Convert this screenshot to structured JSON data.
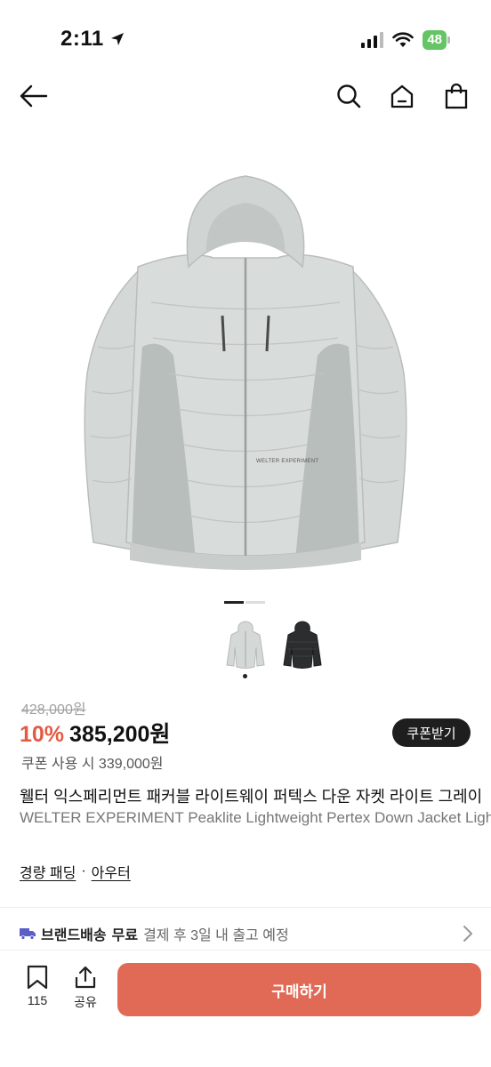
{
  "status": {
    "time": "2:11",
    "battery": "48"
  },
  "product": {
    "original_price": "428,000원",
    "discount": "10%",
    "sale_price": "385,200원",
    "coupon_button": "쿠폰받기",
    "coupon_price": "쿠폰 사용 시 339,000원",
    "title_ko": "웰터 익스페리먼트 패커블 라이트웨이 퍼텍스 다운 자켓 라이트 그레이",
    "title_en": "WELTER EXPERIMENT Peaklite Lightweight Pertex Down Jacket Light Grey",
    "jacket_print": "WELTER EXPERIMENT"
  },
  "category": {
    "first": "경량 패딩",
    "sep": "·",
    "second": "아우터"
  },
  "shipping": {
    "brand": "브랜드배송",
    "free": "무료",
    "eta": "결제 후 3일 내 출고 예정"
  },
  "bottom": {
    "likes": "115",
    "share": "공유",
    "buy": "구매하기"
  },
  "colors": {
    "accent": "#e16a56",
    "discount": "#e25b44",
    "jacket": "#d4d8d6",
    "jacket_panel": "#b8bebc"
  },
  "icons": [
    "back-arrow-icon",
    "search-icon",
    "home-icon",
    "shopping-bag-icon",
    "truck-icon",
    "chevron-right-icon",
    "bookmark-icon",
    "share-icon",
    "location-arrow-icon",
    "signal-icon",
    "wifi-icon"
  ]
}
